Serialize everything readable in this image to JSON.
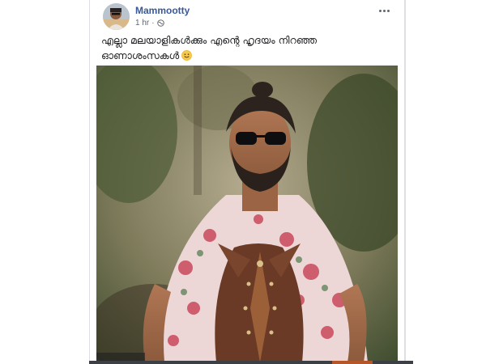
{
  "post": {
    "author": "Mammootty",
    "timestamp": "1 hr",
    "privacy_icon": "globe-icon",
    "options_icon": "more-options-icon",
    "text": "എല്ലാ മലയാളികൾക്കും എന്റെ ഹൃദയം നിറഞ്ഞ ഓണാശംസകൾ",
    "emoji": "smiling-face-emoji",
    "photo": "man-on-horseback-photo"
  },
  "colors": {
    "author_link": "#385898",
    "meta_text": "#606770",
    "body_text": "#1c1e21",
    "card_border": "#dddfe2"
  }
}
